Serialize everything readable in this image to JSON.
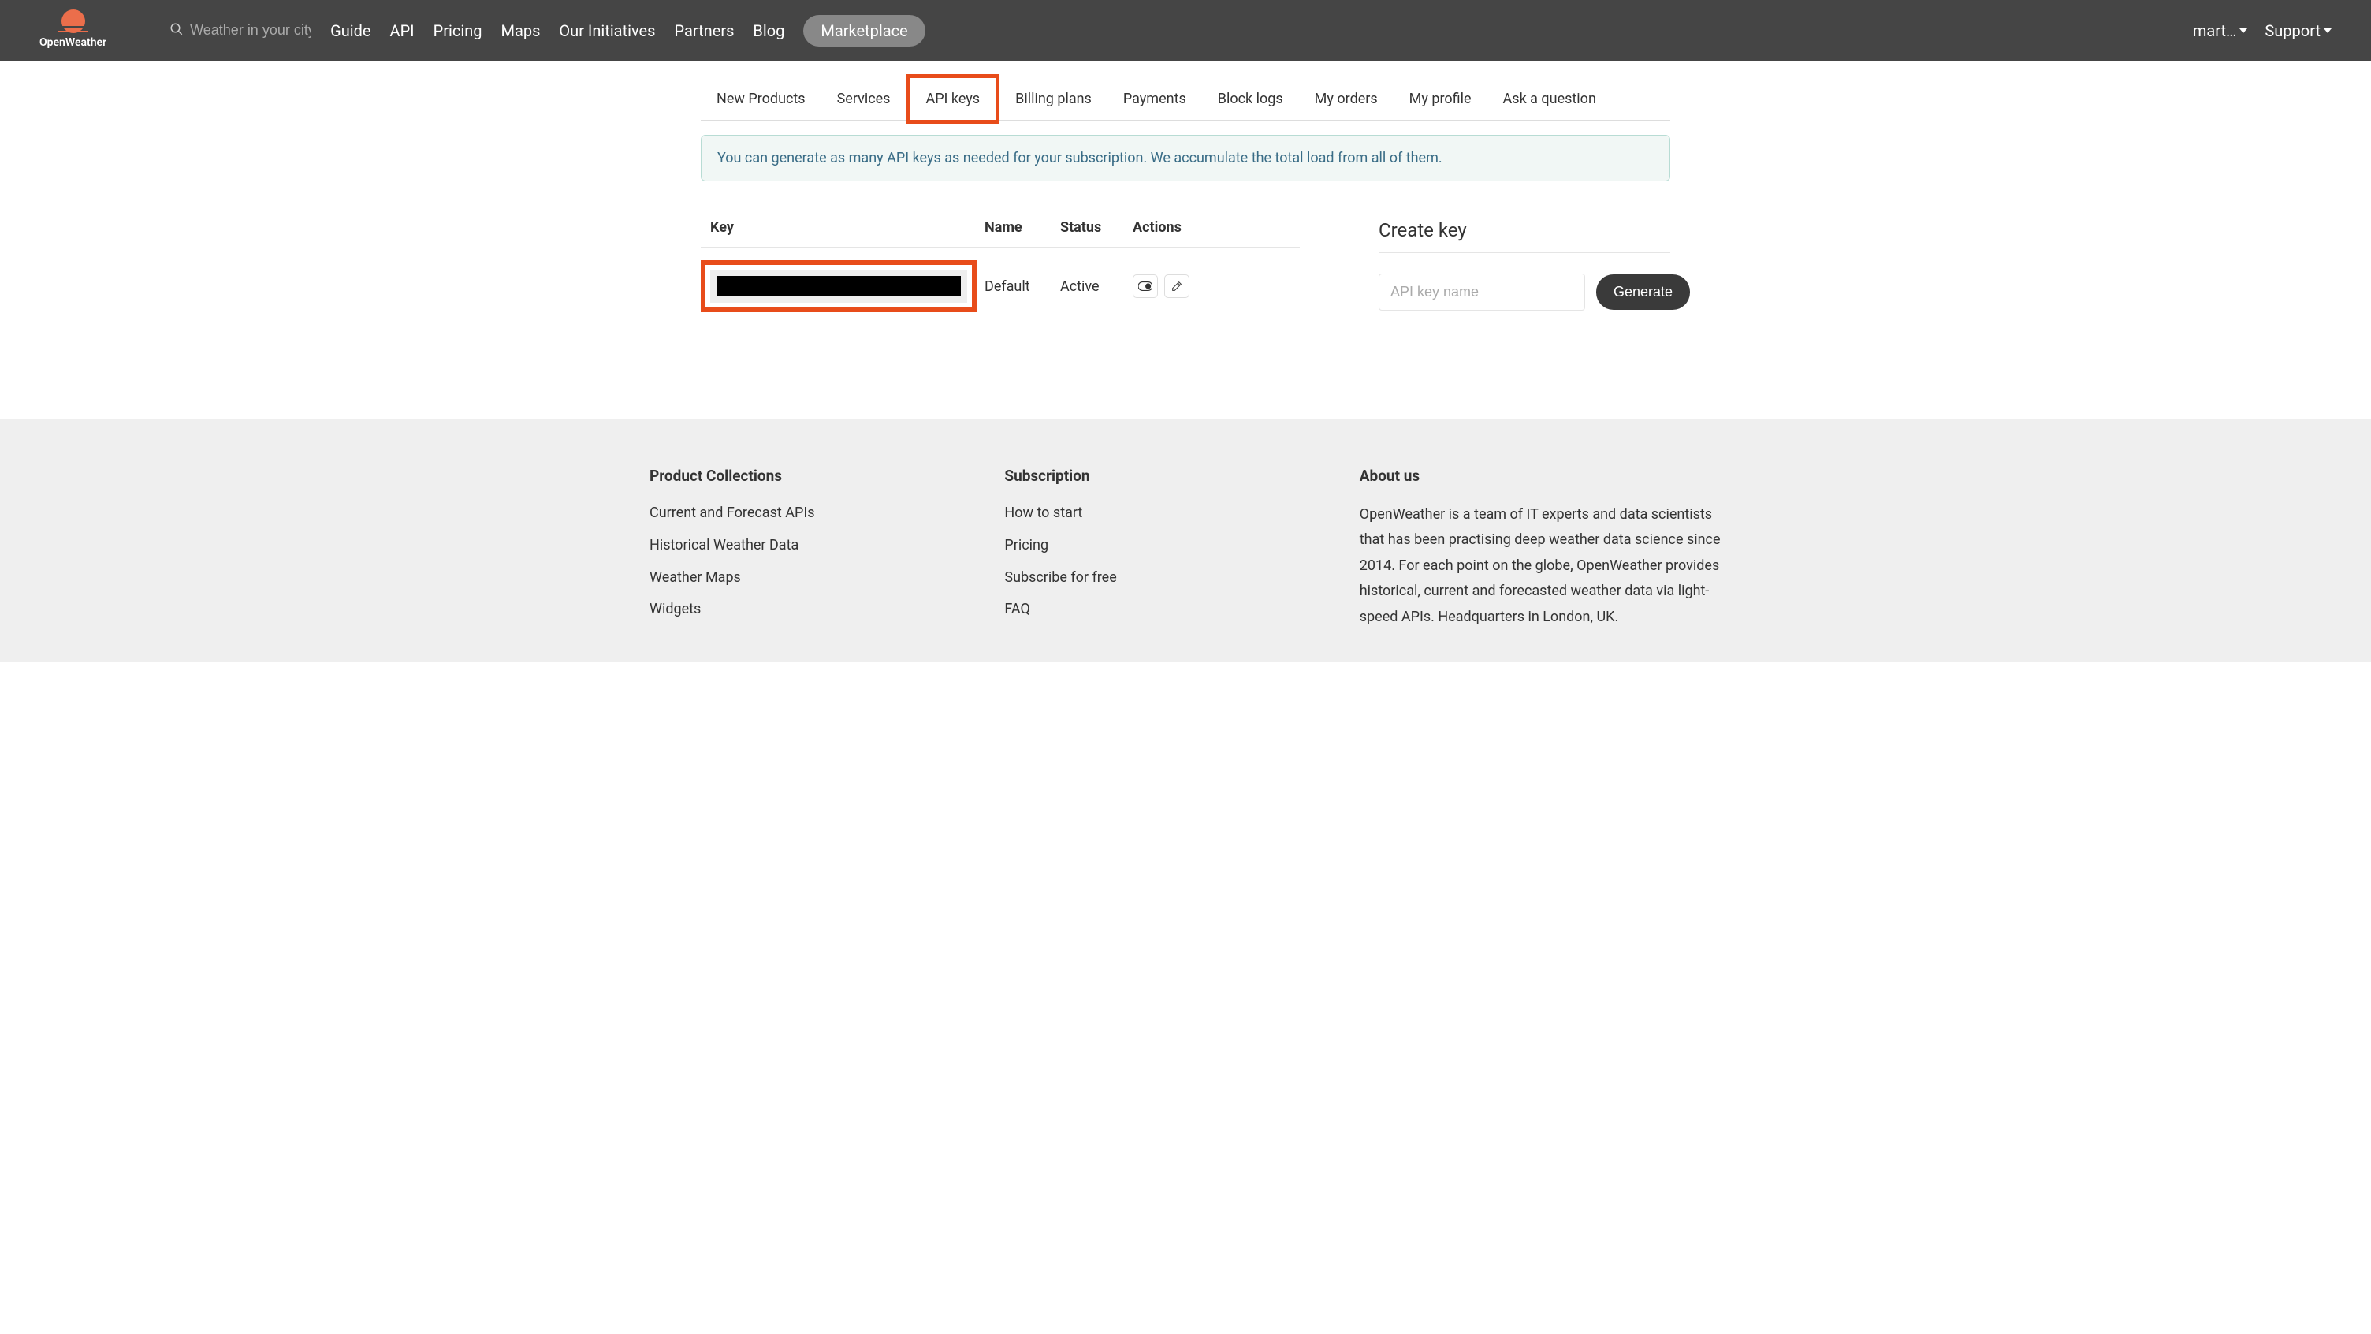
{
  "header": {
    "logo_text": "OpenWeather",
    "search_placeholder": "Weather in your city",
    "nav": [
      "Guide",
      "API",
      "Pricing",
      "Maps",
      "Our Initiatives",
      "Partners",
      "Blog"
    ],
    "marketplace": "Marketplace",
    "user": "mart…",
    "support": "Support"
  },
  "tabs": [
    "New Products",
    "Services",
    "API keys",
    "Billing plans",
    "Payments",
    "Block logs",
    "My orders",
    "My profile",
    "Ask a question"
  ],
  "alert": "You can generate as many API keys as needed for your subscription. We accumulate the total load from all of them.",
  "table": {
    "headers": {
      "key": "Key",
      "name": "Name",
      "status": "Status",
      "actions": "Actions"
    },
    "rows": [
      {
        "key": "████████████████████████████████",
        "name": "Default",
        "status": "Active"
      }
    ]
  },
  "create": {
    "title": "Create key",
    "placeholder": "API key name",
    "button": "Generate"
  },
  "footer": {
    "col1": {
      "heading": "Product Collections",
      "links": [
        "Current and Forecast APIs",
        "Historical Weather Data",
        "Weather Maps",
        "Widgets"
      ]
    },
    "col2": {
      "heading": "Subscription",
      "links": [
        "How to start",
        "Pricing",
        "Subscribe for free",
        "FAQ"
      ]
    },
    "col3": {
      "heading": "About us",
      "text": "OpenWeather is a team of IT experts and data scientists that has been practising deep weather data science since 2014. For each point on the globe, OpenWeather provides historical, current and forecasted weather data via light-speed APIs. Headquarters in London, UK."
    }
  }
}
